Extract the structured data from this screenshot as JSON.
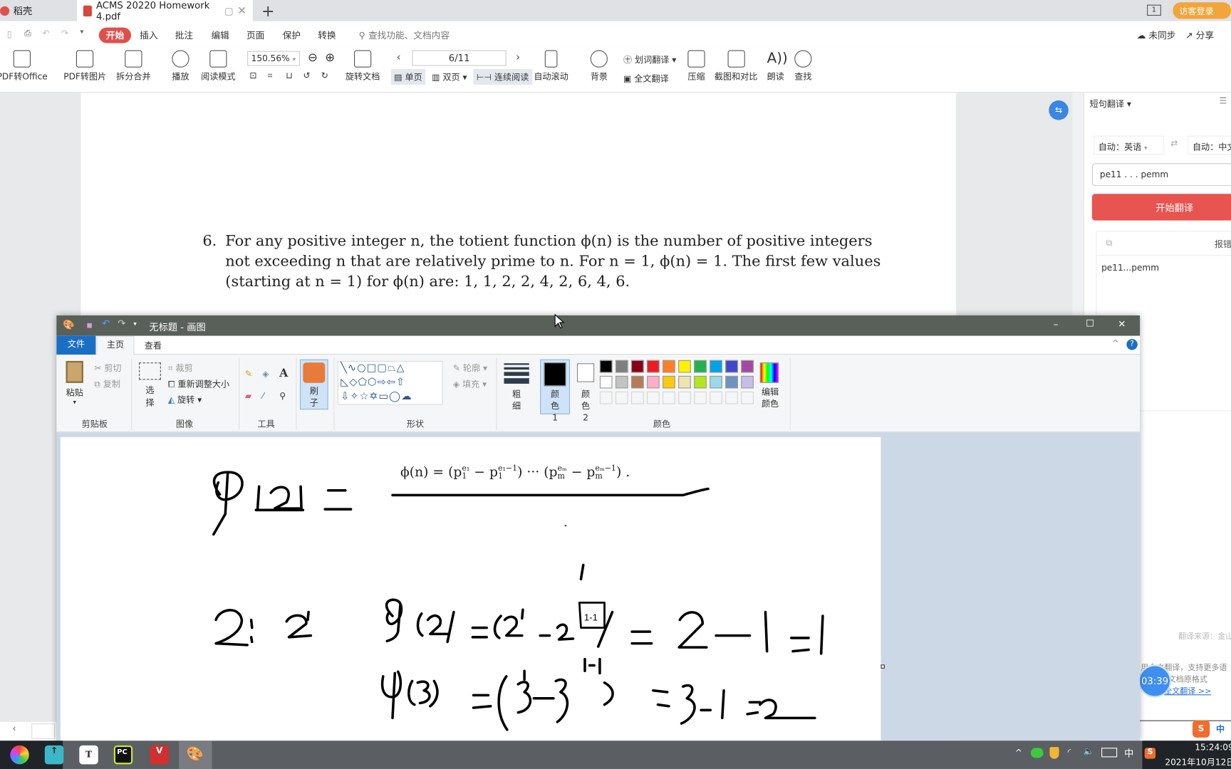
{
  "wps": {
    "tabs": [
      {
        "label": "稻壳"
      },
      {
        "label": "ACMS 20220 Homework 4.pdf"
      }
    ],
    "new_tab": "+",
    "guest_login": "访客登录",
    "page_badge": "1",
    "menu": [
      "开始",
      "插入",
      "批注",
      "编辑",
      "页面",
      "保护",
      "转换"
    ],
    "search_placeholder": "查找功能、文档内容",
    "sync": "未同步",
    "share": "分享",
    "toolbar": {
      "pdf_to_office": "PDF转Office",
      "pdf_to_image": "PDF转图片",
      "split_merge": "拆分合并",
      "play": "播放",
      "read_mode": "阅读模式",
      "zoom": "150.56%",
      "rotate_doc": "旋转文档",
      "page": "6/11",
      "single_page": "单页",
      "double_page": "双页",
      "continuous": "连续阅读",
      "auto_scroll": "自动滚动",
      "background": "背景",
      "word_translate": "划词翻译",
      "full_translate": "全文翻译",
      "compress": "压缩",
      "screenshot_compare": "截图和对比",
      "read_aloud": "朗读",
      "find": "查找"
    }
  },
  "document": {
    "item_number": "6.",
    "lines": [
      "For any positive integer n, the totient function ϕ(n) is the number of positive integers",
      "not exceeding n that are relatively prime to n. For n = 1, ϕ(n) = 1. The first few values",
      "(starting at n = 1) for ϕ(n) are: 1, 1, 2, 2, 4, 2, 6, 4, 6."
    ]
  },
  "translate_panel": {
    "mode": "短句翻译",
    "source_lang": "自动：英语",
    "target_lang": "自动：中文",
    "input": "pe11 . . . pemm",
    "start_button": "开始翻译",
    "report": "报错",
    "result": "pe11...pemm",
    "source_note": "翻译来源：金山",
    "promo_line1": "用全文翻译，支持更多语",
    "promo_line2": "文档原格式",
    "promo_link": "全文翻译 >>",
    "timer": "03:39",
    "ime": "中"
  },
  "paint": {
    "title": "无标题 - 画图",
    "tabs": [
      "文件",
      "主页",
      "查看"
    ],
    "clipboard": {
      "paste": "粘贴",
      "cut": "剪切",
      "copy": "复制",
      "label": "剪贴板"
    },
    "image": {
      "select": "选择",
      "crop": "裁剪",
      "resize": "重新调整大小",
      "rotate": "旋转",
      "label": "图像"
    },
    "tools": {
      "label": "工具"
    },
    "brush": "刷子",
    "shapes": {
      "outline": "轮廓",
      "fill": "填充",
      "label": "形状"
    },
    "size": "粗细",
    "color1": "颜色 1",
    "color2": "颜色 2",
    "edit_colors": "编辑颜色",
    "colors_label": "颜色",
    "palette": [
      [
        "#000000",
        "#7f7f7f",
        "#880015",
        "#ed1c24",
        "#ff7f27",
        "#fff200",
        "#22b14c",
        "#00a2e8",
        "#3f48cc",
        "#a349a4"
      ],
      [
        "#ffffff",
        "#c3c3c3",
        "#b97a57",
        "#ffaec9",
        "#ffc90e",
        "#efe4b0",
        "#b5e61d",
        "#99d9ea",
        "#7092be",
        "#c8bfe7"
      ]
    ],
    "canvas": {
      "formula": [
        {
          "t": "ϕ(n) = (p"
        },
        {
          "sub": "1",
          "sup": "e₁"
        },
        {
          "t": " − p"
        },
        {
          "sub": "1",
          "sup": "e₁−1"
        },
        {
          "t": ") ··· (p"
        },
        {
          "sub": "m",
          "sup": "eₘ"
        },
        {
          "t": " − p"
        },
        {
          "sub": "m",
          "sup": "eₘ−1"
        },
        {
          "t": ") ."
        }
      ],
      "boxed_exponent": "1-1",
      "superscript_1": "1-1"
    }
  },
  "taskbar": {
    "time": "15:24:09",
    "date": "2021年10月12日",
    "ime": "中"
  }
}
